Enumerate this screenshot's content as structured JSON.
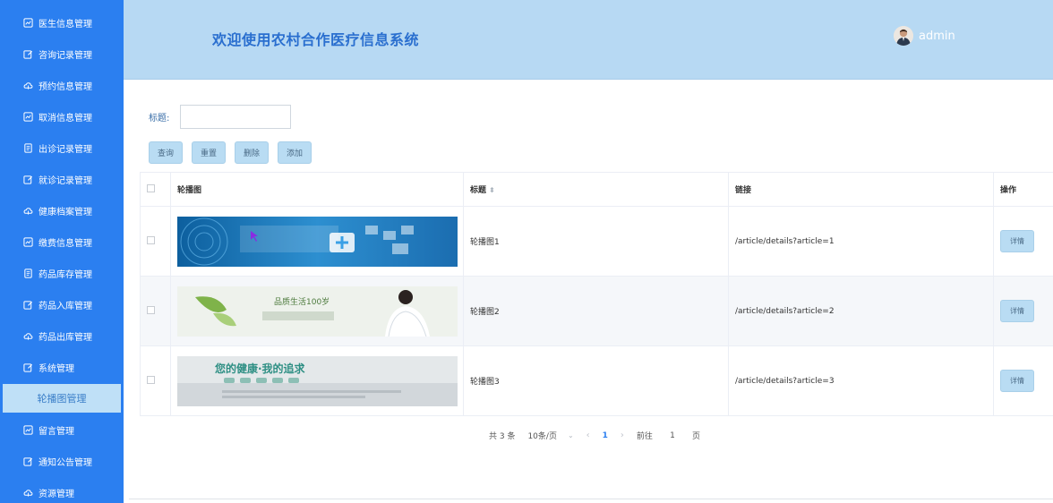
{
  "header": {
    "title": "欢迎使用农村合作医疗信息系统",
    "username": "admin"
  },
  "sidebar": {
    "items": [
      {
        "label": "医生信息管理",
        "icon": "chart-icon"
      },
      {
        "label": "咨询记录管理",
        "icon": "edit-icon"
      },
      {
        "label": "预约信息管理",
        "icon": "cloud-icon"
      },
      {
        "label": "取消信息管理",
        "icon": "chart-icon"
      },
      {
        "label": "出诊记录管理",
        "icon": "document-icon"
      },
      {
        "label": "就诊记录管理",
        "icon": "edit-icon"
      },
      {
        "label": "健康档案管理",
        "icon": "cloud-icon"
      },
      {
        "label": "缴费信息管理",
        "icon": "chart-icon"
      },
      {
        "label": "药品库存管理",
        "icon": "document-icon"
      },
      {
        "label": "药品入库管理",
        "icon": "edit-icon"
      },
      {
        "label": "药品出库管理",
        "icon": "cloud-icon"
      },
      {
        "label": "系统管理",
        "icon": "edit-icon"
      },
      {
        "label": "轮播图管理",
        "icon": "",
        "active": true
      },
      {
        "label": "留言管理",
        "icon": "chart-icon"
      },
      {
        "label": "通知公告管理",
        "icon": "edit-icon"
      },
      {
        "label": "资源管理",
        "icon": "cloud-icon"
      }
    ]
  },
  "search": {
    "label": "标题:",
    "value": "",
    "placeholder": ""
  },
  "buttons": {
    "query": "查询",
    "reset": "重置",
    "delete": "删除",
    "add": "添加"
  },
  "table": {
    "headers": {
      "image": "轮播图",
      "title": "标题",
      "link": "链接",
      "action": "操作"
    },
    "rows": [
      {
        "title": "轮播图1",
        "link": "/article/details?article=1",
        "action": "详情"
      },
      {
        "title": "轮播图2",
        "link": "/article/details?article=2",
        "action": "详情"
      },
      {
        "title": "轮播图3",
        "link": "/article/details?article=3",
        "action": "详情"
      }
    ],
    "banner2_text": "品质生活100岁",
    "banner3_text": "您的健康·我的追求"
  },
  "pagination": {
    "total": "共 3 条",
    "page_size": "10条/页",
    "current_page": "1",
    "goto_label": "前往",
    "goto_value": "1",
    "page_suffix": "页"
  },
  "colors": {
    "sidebar": "#2b7ff0",
    "header": "#b7d9f3",
    "button": "#b9dcf3",
    "title": "#2a6fcf"
  }
}
